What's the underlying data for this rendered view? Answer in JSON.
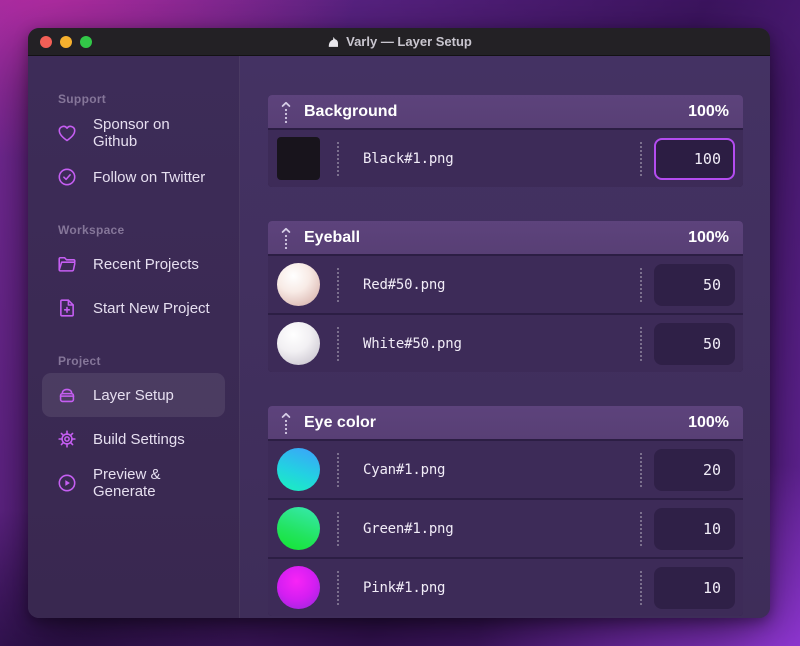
{
  "window": {
    "title": "Varly — Layer Setup"
  },
  "colors": {
    "accent_purple": "#c55ef2",
    "focus_border": "#b44cf0",
    "traffic_red": "#f35f57",
    "traffic_yellow": "#f5b02e",
    "traffic_green": "#32c748"
  },
  "sidebar": {
    "sections": [
      {
        "label": "Support",
        "items": [
          {
            "icon": "heart-icon",
            "label": "Sponsor on Github"
          },
          {
            "icon": "badge-check-icon",
            "label": "Follow on Twitter"
          }
        ]
      },
      {
        "label": "Workspace",
        "items": [
          {
            "icon": "folder-icon",
            "label": "Recent Projects"
          },
          {
            "icon": "file-plus-icon",
            "label": "Start New Project"
          }
        ]
      },
      {
        "label": "Project",
        "items": [
          {
            "icon": "archive-box-icon",
            "label": "Layer Setup",
            "selected": true
          },
          {
            "icon": "gear-icon",
            "label": "Build Settings"
          },
          {
            "icon": "play-circle-icon",
            "label": "Preview & Generate"
          }
        ]
      }
    ]
  },
  "layers": {
    "groups": [
      {
        "name": "Background",
        "weight": "100%",
        "rows": [
          {
            "thumb": "black-square",
            "file": "Black#1.png",
            "value": "100",
            "focused": true
          }
        ]
      },
      {
        "name": "Eyeball",
        "weight": "100%",
        "rows": [
          {
            "thumb": "red-sphere",
            "file": "Red#50.png",
            "value": "50"
          },
          {
            "thumb": "white-sphere",
            "file": "White#50.png",
            "value": "50"
          }
        ]
      },
      {
        "name": "Eye color",
        "weight": "100%",
        "rows": [
          {
            "thumb": "cyan-circle",
            "file": "Cyan#1.png",
            "value": "20"
          },
          {
            "thumb": "green-circle",
            "file": "Green#1.png",
            "value": "10"
          },
          {
            "thumb": "pink-circle",
            "file": "Pink#1.png",
            "value": "10"
          }
        ]
      }
    ]
  }
}
